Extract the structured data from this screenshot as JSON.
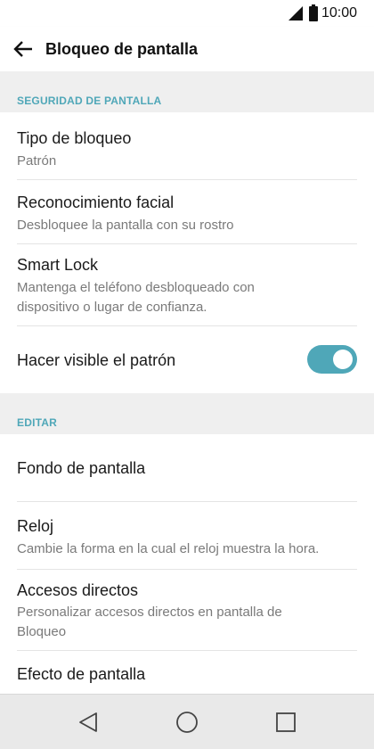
{
  "status_bar": {
    "time": "10:00",
    "signal_icon": "signal-icon",
    "battery_icon": "battery-icon"
  },
  "app_bar": {
    "title": "Bloqueo de pantalla",
    "back_icon": "arrow-left-icon"
  },
  "sections": [
    {
      "header": "SEGURIDAD DE PANTALLA",
      "items": [
        {
          "title": "Tipo de bloqueo",
          "subtitle": "Patrón"
        },
        {
          "title": "Reconocimiento facial",
          "subtitle": "Desbloquee la pantalla con su rostro"
        },
        {
          "title": "Smart Lock",
          "subtitle_line1": "Mantenga el teléfono desbloqueado con",
          "subtitle_line2": "dispositivo o lugar de confianza."
        },
        {
          "title": "Hacer visible el patrón",
          "toggle_on": true
        }
      ]
    },
    {
      "header": "EDITAR",
      "items": [
        {
          "title": "Fondo de pantalla"
        },
        {
          "title": "Reloj",
          "subtitle": "Cambie la forma en la cual el reloj muestra la hora."
        },
        {
          "title": "Accesos directos",
          "subtitle_line1": "Personalizar accesos directos en pantalla de",
          "subtitle_line2": "Bloqueo"
        },
        {
          "title": "Efecto de pantalla"
        }
      ]
    }
  ],
  "nav_bar": {
    "back_icon": "triangle-back-icon",
    "home_icon": "circle-home-icon",
    "recents_icon": "square-recents-icon"
  },
  "colors": {
    "accent": "#4fa7b8",
    "background": "#efefef",
    "nav_bar": "#e9e9e9"
  }
}
